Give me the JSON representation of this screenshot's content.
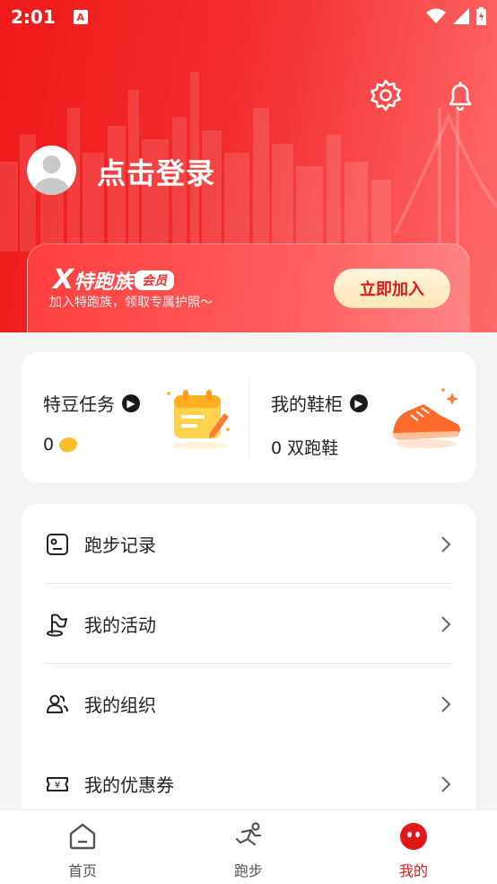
{
  "status_bar": {
    "time": "2:01",
    "notification_badge": "A"
  },
  "header": {
    "login_text": "点击登录",
    "member": {
      "brand_x": "X",
      "brand_name": "特跑族",
      "brand_badge": "会员",
      "description": "加入特跑族，领取专属护照～",
      "join_button": "立即加入"
    }
  },
  "stats": {
    "beans": {
      "title": "特豆任务",
      "value": "0"
    },
    "shoes": {
      "title": "我的鞋柜",
      "value": "0 双跑鞋"
    }
  },
  "menu": {
    "items": [
      {
        "label": "跑步记录",
        "icon": "run-record-icon"
      },
      {
        "label": "我的活动",
        "icon": "activity-flag-icon"
      },
      {
        "label": "我的组织",
        "icon": "group-icon"
      },
      {
        "label": "我的优惠券",
        "icon": "coupon-icon"
      }
    ]
  },
  "tabbar": {
    "tabs": [
      {
        "label": "首页",
        "icon": "home-icon"
      },
      {
        "label": "跑步",
        "icon": "runner-icon"
      },
      {
        "label": "我的",
        "icon": "profile-face-icon",
        "active": true
      }
    ]
  },
  "colors": {
    "accent": "#e01818",
    "header_start": "#ee1a1a",
    "header_end": "#ff6a6a",
    "join_button_bg": "#ffe7b6"
  }
}
